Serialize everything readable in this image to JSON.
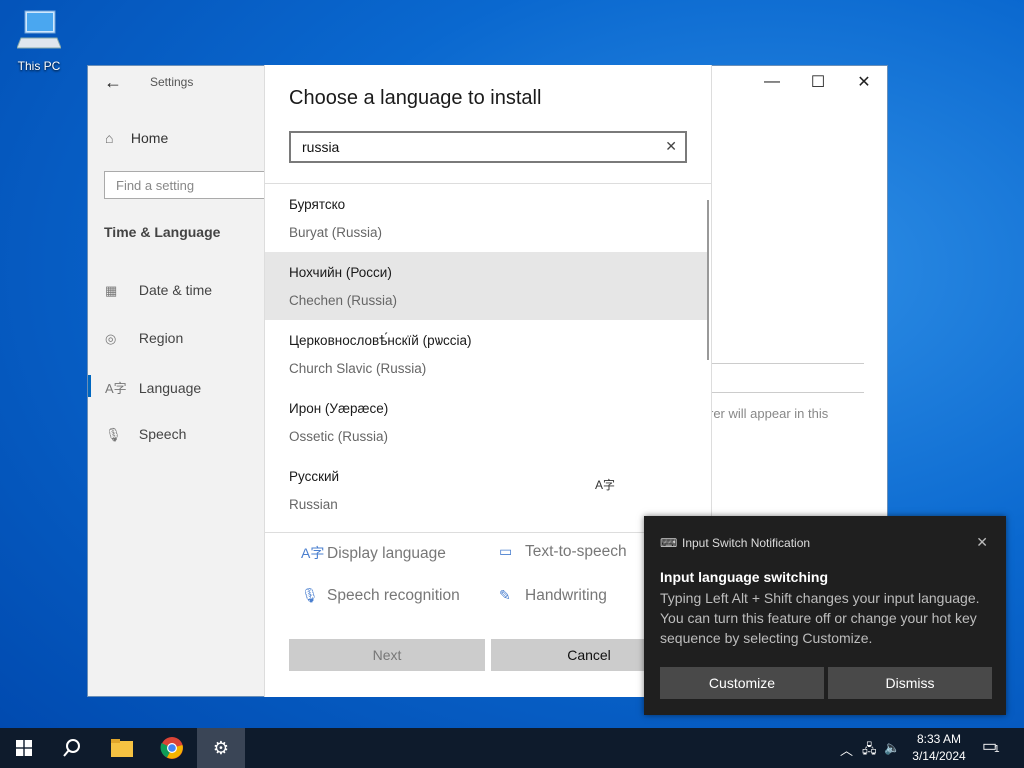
{
  "desktop": {
    "icon_label": "This PC"
  },
  "settings": {
    "app_title": "Settings",
    "home_label": "Home",
    "find_placeholder": "Find a setting",
    "section_title": "Time & Language",
    "nav_items": [
      {
        "label": "Date & time",
        "icon": "calendar-clock-icon"
      },
      {
        "label": "Region",
        "icon": "globe-icon"
      },
      {
        "label": "Language",
        "icon": "language-icon"
      },
      {
        "label": "Speech",
        "icon": "microphone-icon"
      }
    ],
    "background_text": "rer will appear in this"
  },
  "dialog": {
    "title": "Choose a language to install",
    "search_value": "russia",
    "languages": [
      {
        "native": "Бурятско",
        "english": "Buryat (Russia)"
      },
      {
        "native": "Нохчийн (Росси)",
        "english": "Chechen (Russia)"
      },
      {
        "native": "Церковнословѣ́нскїй (рѡссіа)",
        "english": "Church Slavic (Russia)"
      },
      {
        "native": "Ирон (Уæрæсе)",
        "english": "Ossetic (Russia)"
      },
      {
        "native": "Русский",
        "english": "Russian"
      }
    ],
    "features": {
      "display_language": "Display language",
      "text_to_speech": "Text-to-speech",
      "speech_recognition": "Speech recognition",
      "handwriting": "Handwriting"
    },
    "next_label": "Next",
    "cancel_label": "Cancel"
  },
  "toast": {
    "header": "Input Switch Notification",
    "title": "Input language switching",
    "body": "Typing Left Alt + Shift changes your input language. You can turn this feature off or change your hot key sequence by selecting Customize.",
    "customize_label": "Customize",
    "dismiss_label": "Dismiss"
  },
  "taskbar": {
    "time": "8:33 AM",
    "date": "3/14/2024",
    "notification_count": "1"
  }
}
